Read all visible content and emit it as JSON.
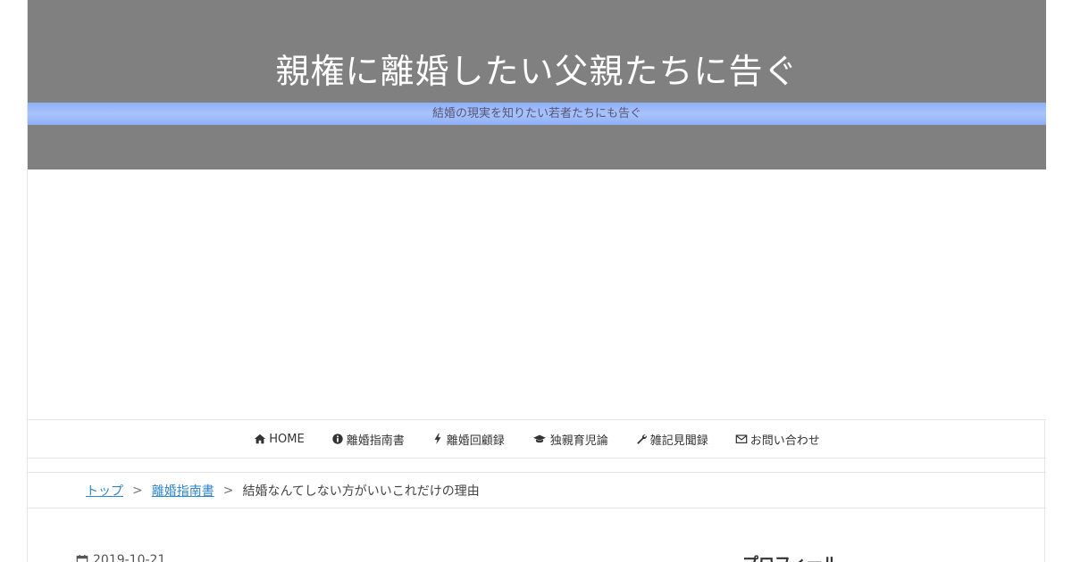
{
  "header": {
    "site_title": "親権に離婚したい父親たちに告ぐ",
    "tagline": "結婚の現実を知りたい若者たちにも告ぐ"
  },
  "nav": {
    "items": [
      {
        "label": "HOME",
        "icon": "home-icon"
      },
      {
        "label": "離婚指南書",
        "icon": "info-circle-icon"
      },
      {
        "label": "離婚回顧録",
        "icon": "bolt-icon"
      },
      {
        "label": "独親育児論",
        "icon": "graduation-cap-icon"
      },
      {
        "label": "雑記見聞録",
        "icon": "wrench-icon"
      },
      {
        "label": "お問い合わせ",
        "icon": "envelope-icon"
      }
    ]
  },
  "breadcrumb": {
    "top": "トップ",
    "separator": ">",
    "category": "離婚指南書",
    "current": "結婚なんてしない方がいいこれだけの理由"
  },
  "post": {
    "date": "2019-10-21"
  },
  "sidebar": {
    "heading": "プロフィール"
  },
  "colors": {
    "header_bg": "#808080",
    "tagline_bar": "#a0bcfa",
    "link": "#2f86c9"
  }
}
